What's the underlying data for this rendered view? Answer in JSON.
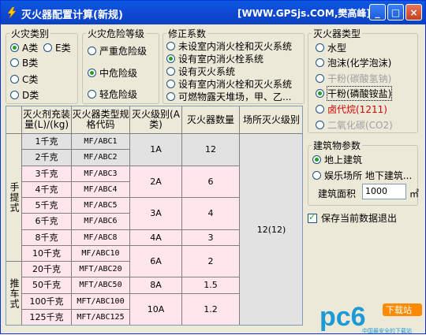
{
  "window": {
    "title": "灭火器配置计算(新规)",
    "site": "[WWW.GPSjs.COM,樊高峰]",
    "min_glyph": "_",
    "max_glyph": "□",
    "close_glyph": "×"
  },
  "fire_class": {
    "legend": "火灾类别",
    "options": [
      "A类",
      "E类",
      "B类",
      "C类",
      "D类"
    ],
    "selected": "A类"
  },
  "danger_level": {
    "legend": "火灾危险等级",
    "options": [
      "严重危险级",
      "中危险级",
      "轻危险级"
    ],
    "selected": "中危险级"
  },
  "correction": {
    "legend": "修正系数",
    "options": [
      "未设室内消火栓和灭火系统",
      "设有室内消火栓系统",
      "设有灭火系统",
      "设有室内消火栓和灭火系统",
      "可燃物露天堆场，甲、乙..."
    ],
    "selected": "设有室内消火栓系统"
  },
  "extinguisher_type": {
    "legend": "灭火器类型",
    "options": [
      "水型",
      "泡沫(化学泡沫)",
      "干粉(碳酸氢钠)",
      "干粉(磷酸铵盐)",
      "卤代烷(1211)",
      "二氧化碳(CO2)"
    ],
    "selected": "干粉(磷酸铵盐)"
  },
  "building": {
    "legend": "建筑物参数",
    "options": [
      "地上建筑",
      "娱乐场所 地下建筑..."
    ],
    "selected": "地上建筑",
    "area_label": "建筑面积",
    "area_value": "1000",
    "area_unit": "㎡"
  },
  "save_exit_label": "保存当前数据退出",
  "table": {
    "headers": [
      "灭火剂充装量(L)/(kg)",
      "灭火器类型规格代码",
      "灭火级别(A类)",
      "灭火器数量",
      "场所灭火级别"
    ],
    "groups": [
      "手提式",
      "推车式"
    ],
    "rows": [
      {
        "charge": "1千克",
        "code": "MF/ABC1"
      },
      {
        "charge": "2千克",
        "code": "MF/ABC2"
      },
      {
        "charge": "3千克",
        "code": "MF/ABC3"
      },
      {
        "charge": "4千克",
        "code": "MF/ABC4"
      },
      {
        "charge": "5千克",
        "code": "MF/ABC5"
      },
      {
        "charge": "6千克",
        "code": "MF/ABC6"
      },
      {
        "charge": "8千克",
        "code": "MF/ABC8"
      },
      {
        "charge": "10千克",
        "code": "MF/ABC10"
      },
      {
        "charge": "20千克",
        "code": "MFT/ABC20"
      },
      {
        "charge": "50千克",
        "code": "MFT/ABC50"
      },
      {
        "charge": "100千克",
        "code": "MFT/ABC100"
      },
      {
        "charge": "125千克",
        "code": "MFT/ABC125"
      }
    ],
    "rating_groups": [
      {
        "level": "1A",
        "count": "12"
      },
      {
        "level": "2A",
        "count": "6"
      },
      {
        "level": "3A",
        "count": "4"
      },
      {
        "level": "4A",
        "count": "3"
      },
      {
        "level": "6A",
        "count": "2"
      },
      {
        "level": "8A",
        "count": "1.5"
      },
      {
        "level": "10A",
        "count": "1.2"
      }
    ],
    "site_level": "12(12)"
  },
  "watermark": {
    "text": "pc6",
    "badge": "下载站",
    "sub": "中国最安全的下载站"
  },
  "colors": {
    "title_bar": "#0b41c3",
    "selected_radio": "#21a121",
    "pink_row": "#ffe6ec",
    "gray_row": "#e2e2e2",
    "halon_red": "#d00000"
  }
}
